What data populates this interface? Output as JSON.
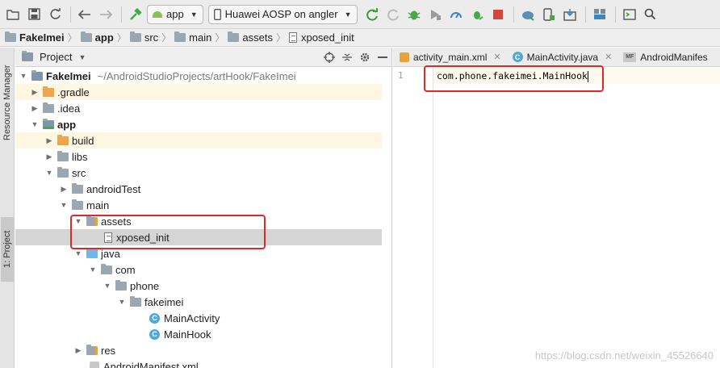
{
  "toolbar": {
    "run_config": "app",
    "device": "Huawei AOSP on angler"
  },
  "breadcrumb": [
    "FakeImei",
    "app",
    "src",
    "main",
    "assets",
    "xposed_init"
  ],
  "left_strip": {
    "resource_manager": "Resource Manager",
    "project": "1: Project"
  },
  "project_panel": {
    "title": "Project",
    "root_name": "FakeImei",
    "root_path": "~/AndroidStudioProjects/artHook/FakeImei",
    "items": [
      {
        "label": ".gradle"
      },
      {
        "label": ".idea"
      },
      {
        "label": "app"
      },
      {
        "label": "build"
      },
      {
        "label": "libs"
      },
      {
        "label": "src"
      },
      {
        "label": "androidTest"
      },
      {
        "label": "main"
      },
      {
        "label": "assets"
      },
      {
        "label": "xposed_init"
      },
      {
        "label": "java"
      },
      {
        "label": "com"
      },
      {
        "label": "phone"
      },
      {
        "label": "fakeimei"
      },
      {
        "label": "MainActivity"
      },
      {
        "label": "MainHook"
      },
      {
        "label": "res"
      },
      {
        "label": "AndroidManifest.xml"
      }
    ]
  },
  "editor": {
    "tabs": [
      {
        "label": "activity_main.xml"
      },
      {
        "label": "MainActivity.java"
      },
      {
        "label": "AndroidManifes"
      }
    ],
    "line_number": "1",
    "code": "com.phone.fakeimei.MainHook"
  },
  "icons": {
    "class_letter": "C",
    "manifest_badge": "MF"
  },
  "colors": {
    "annotation": "#e0282a",
    "selection": "#d5d5d5",
    "highlight": "#fdf6e0",
    "android_green": "#8cc152"
  },
  "watermark": "https://blog.csdn.net/weixin_45526640"
}
